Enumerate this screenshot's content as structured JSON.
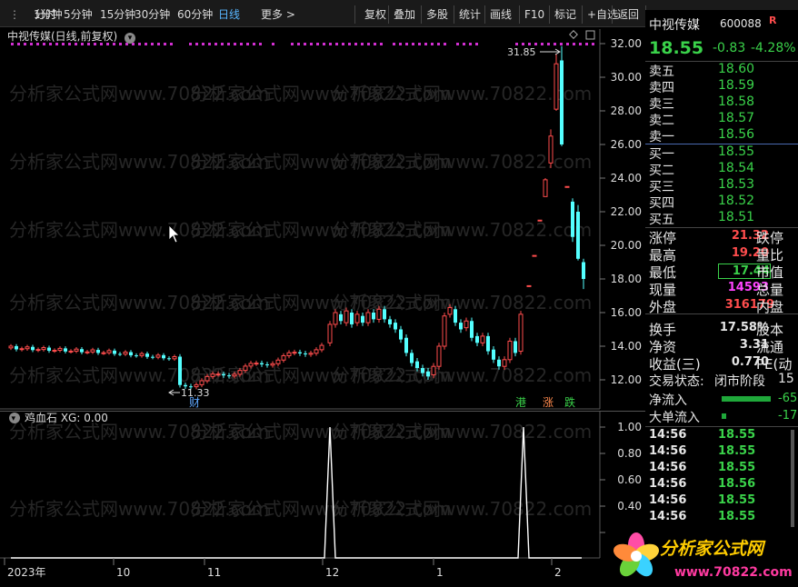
{
  "toolbar": {
    "periods": [
      "分时",
      "1分钟",
      "5分钟",
      "15分钟",
      "30分钟",
      "60分钟",
      "日线",
      "更多 >"
    ],
    "active_period": "日线",
    "tools": [
      "复权",
      "叠加",
      "多股",
      "统计",
      "画线",
      "F10",
      "标记",
      "+自选",
      "返回"
    ]
  },
  "chart": {
    "title": "中视传媒(日线,前复权)",
    "watermark": "分析家公式网www.70822.com",
    "high_label": "31.85",
    "low_label": "11.33",
    "event_labels": [
      "财",
      "港",
      "涨",
      "跌"
    ],
    "y_ticks": [
      "32.00",
      "30.00",
      "28.00",
      "26.00",
      "24.00",
      "22.00",
      "20.00",
      "18.00",
      "16.00",
      "14.00",
      "12.00"
    ],
    "x_labels": [
      "2023年",
      "10",
      "11",
      "12",
      "1",
      "2"
    ]
  },
  "indicator": {
    "name": "鸡血石",
    "value_label": "XG: 0.00",
    "y_ticks": [
      "1.00",
      "0.80",
      "0.60",
      "0.40",
      "0.20"
    ]
  },
  "quote": {
    "name": "中视传媒",
    "code": "600088",
    "flag": "R",
    "price": "18.55",
    "change": "-0.83",
    "pct": "-4.28%",
    "asks": [
      {
        "label": "卖五",
        "price": "18.60"
      },
      {
        "label": "卖四",
        "price": "18.59"
      },
      {
        "label": "卖三",
        "price": "18.58"
      },
      {
        "label": "卖二",
        "price": "18.57"
      },
      {
        "label": "卖一",
        "price": "18.56"
      }
    ],
    "bids": [
      {
        "label": "买一",
        "price": "18.55"
      },
      {
        "label": "买二",
        "price": "18.54"
      },
      {
        "label": "买三",
        "price": "18.53"
      },
      {
        "label": "买四",
        "price": "18.52"
      },
      {
        "label": "买五",
        "price": "18.51"
      }
    ],
    "stats": [
      {
        "l": "涨停",
        "v": "21.32",
        "r": "跌停"
      },
      {
        "l": "最高",
        "v": "19.20",
        "r": "量比"
      },
      {
        "l": "最低",
        "v": "17.44",
        "r": "市值"
      },
      {
        "l": "现量",
        "v": "14593",
        "r": "总量"
      },
      {
        "l": "外盘",
        "v": "316179",
        "r": "内盘"
      },
      {
        "l": "换手",
        "v": "17.58%",
        "r": "股本"
      },
      {
        "l": "净资",
        "v": "3.31",
        "r": "流通"
      },
      {
        "l": "收益(三)",
        "v": "0.770",
        "r": "PE(动"
      }
    ],
    "trade_status_label": "交易状态:",
    "trade_status": "闭市阶段",
    "trade_status_tail": "15",
    "flows": [
      {
        "l": "净流入",
        "v": "-65"
      },
      {
        "l": "大单流入",
        "v": "-17"
      }
    ],
    "ticks": [
      {
        "t": "14:56",
        "p": "18.55"
      },
      {
        "t": "14:56",
        "p": "18.55"
      },
      {
        "t": "14:56",
        "p": "18.55"
      },
      {
        "t": "14:56",
        "p": "18.56"
      },
      {
        "t": "14:56",
        "p": "18.55"
      },
      {
        "t": "14:56",
        "p": "18.55"
      },
      {
        "t": "14:56",
        "p": "18.55"
      }
    ]
  },
  "logo": {
    "text": "分析家公式网",
    "url": "www.70822.com"
  }
}
